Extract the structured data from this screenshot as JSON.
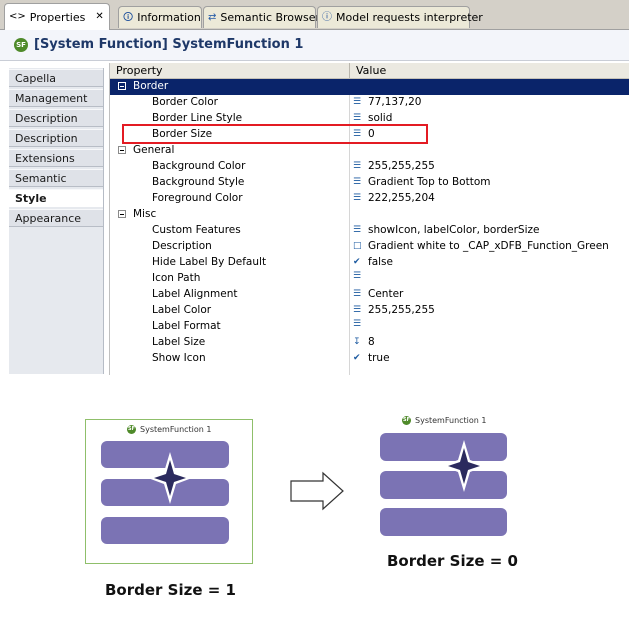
{
  "tabs": [
    {
      "label": "Properties",
      "icon": "properties-icon",
      "active": true
    },
    {
      "label": "Information",
      "icon": "information-icon"
    },
    {
      "label": "Semantic Browser",
      "icon": "semantic-browser-icon"
    },
    {
      "label": "Model requests interpreter",
      "icon": "info-circle-icon"
    }
  ],
  "title": {
    "badge": "SF",
    "text": "[System Function] SystemFunction 1"
  },
  "sidebar": {
    "items": [
      {
        "label": "Capella"
      },
      {
        "label": "Management"
      },
      {
        "label": "Description"
      },
      {
        "label": "Description"
      },
      {
        "label": "Extensions"
      },
      {
        "label": "Semantic"
      },
      {
        "label": "Style",
        "active": true
      },
      {
        "label": "Appearance"
      }
    ]
  },
  "grid": {
    "headers": {
      "property": "Property",
      "value": "Value"
    },
    "rows": [
      {
        "kind": "group",
        "label": "Border",
        "value": "",
        "selected": true
      },
      {
        "kind": "prop",
        "label": "Border Color",
        "value": "77,137,20",
        "icon": "list-icon"
      },
      {
        "kind": "prop",
        "label": "Border Line Style",
        "value": "solid",
        "icon": "list-icon"
      },
      {
        "kind": "prop",
        "label": "Border Size",
        "value": "0",
        "icon": "list-icon",
        "highlighted": true
      },
      {
        "kind": "group",
        "label": "General",
        "value": ""
      },
      {
        "kind": "prop",
        "label": "Background Color",
        "value": "255,255,255",
        "icon": "list-icon"
      },
      {
        "kind": "prop",
        "label": "Background Style",
        "value": "Gradient Top to Bottom",
        "icon": "list-icon"
      },
      {
        "kind": "prop",
        "label": "Foreground Color",
        "value": "222,255,204",
        "icon": "list-icon"
      },
      {
        "kind": "group",
        "label": "Misc",
        "value": ""
      },
      {
        "kind": "prop",
        "label": "Custom Features",
        "value": "showIcon, labelColor, borderSize",
        "icon": "list-icon"
      },
      {
        "kind": "prop",
        "label": "Description",
        "value": "Gradient white to _CAP_xDFB_Function_Green",
        "icon": "note-icon"
      },
      {
        "kind": "prop",
        "label": "Hide Label By Default",
        "value": "false",
        "icon": "checkbox-icon"
      },
      {
        "kind": "prop",
        "label": "Icon Path",
        "value": "",
        "icon": "list-icon"
      },
      {
        "kind": "prop",
        "label": "Label Alignment",
        "value": "Center",
        "icon": "list-icon"
      },
      {
        "kind": "prop",
        "label": "Label Color",
        "value": "255,255,255",
        "icon": "list-icon"
      },
      {
        "kind": "prop",
        "label": "Label Format",
        "value": "",
        "icon": "list-icon"
      },
      {
        "kind": "prop",
        "label": "Label Size",
        "value": "8",
        "icon": "number-icon"
      },
      {
        "kind": "prop",
        "label": "Show Icon",
        "value": "true",
        "icon": "checkbox-icon"
      }
    ]
  },
  "comparison": {
    "left": {
      "node_label": "SystemFunction 1",
      "caption": "Border Size = 1",
      "border_color": "#8fbf6a"
    },
    "right": {
      "node_label": "SystemFunction 1",
      "caption": "Border Size = 0"
    },
    "bar_color": "#7b73b4",
    "star_color": "#2b2a5e"
  }
}
